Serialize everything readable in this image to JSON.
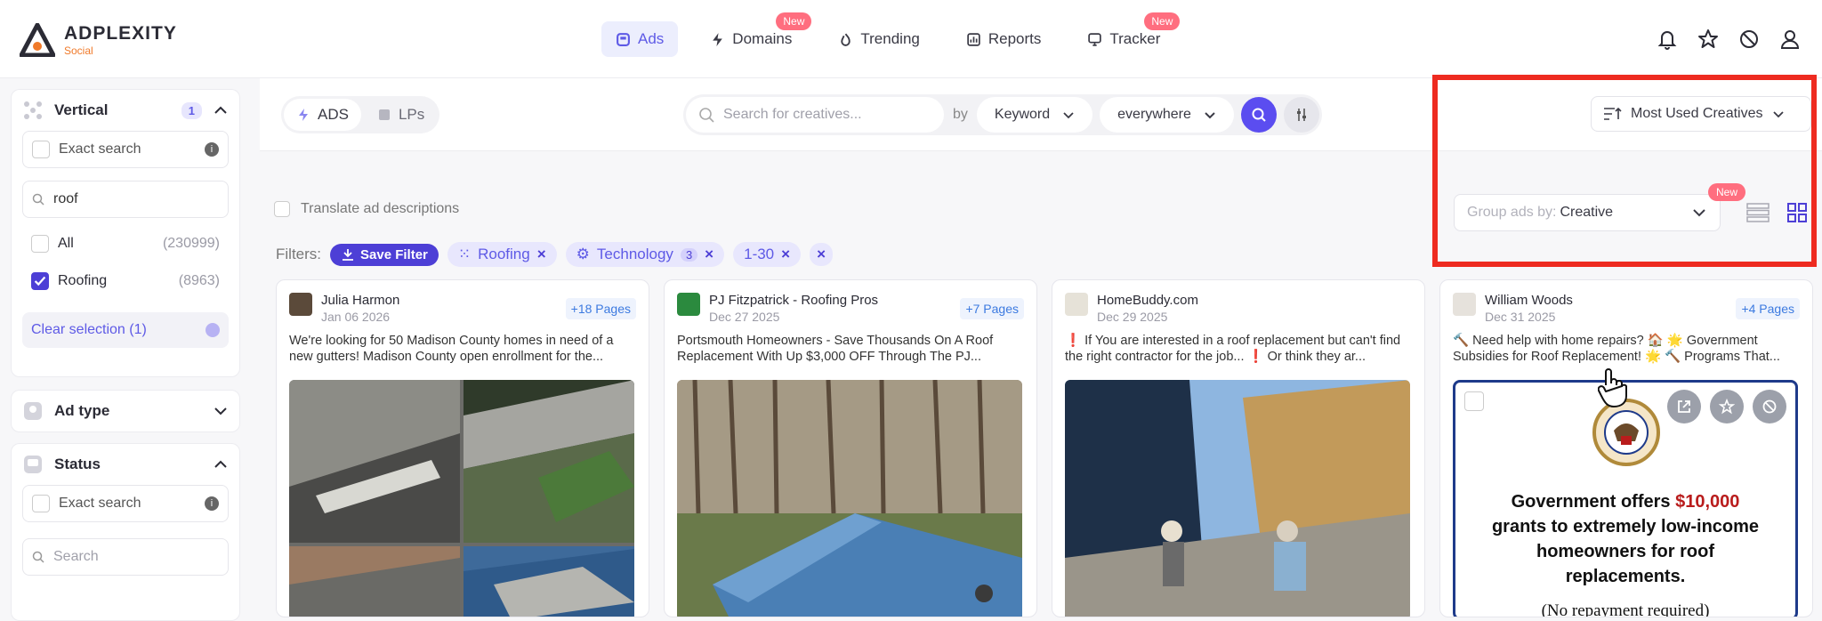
{
  "brand": {
    "title": "ADPLEXITY",
    "subtitle": "Social"
  },
  "nav": [
    {
      "label": "Ads",
      "active": true,
      "icon": "ads-icon"
    },
    {
      "label": "Domains",
      "badge": "New",
      "icon": "bolt-icon"
    },
    {
      "label": "Trending",
      "icon": "flame-icon"
    },
    {
      "label": "Reports",
      "icon": "chart-icon"
    },
    {
      "label": "Tracker",
      "badge": "New",
      "icon": "tracker-icon"
    }
  ],
  "sidebar": {
    "vertical": {
      "title": "Vertical",
      "count": "1",
      "exact_search": "Exact search",
      "search_value": "roof",
      "options": [
        {
          "label": "All",
          "count": "(230999)"
        },
        {
          "label": "Roofing",
          "count": "(8963)"
        }
      ],
      "clear": "Clear selection (1)"
    },
    "ad_type": {
      "title": "Ad type"
    },
    "status": {
      "title": "Status",
      "exact_search": "Exact search",
      "search_placeholder": "Search"
    }
  },
  "toolbar": {
    "seg": [
      {
        "label": "ADS"
      },
      {
        "label": "LPs"
      }
    ],
    "search_placeholder": "Search for creatives...",
    "by": "by",
    "keyword": "Keyword",
    "scope": "everywhere",
    "sort": "Most Used Creatives"
  },
  "translate": "Translate ad descriptions",
  "group_by": {
    "label": "Group ads by:",
    "value": "Creative",
    "badge": "New"
  },
  "filters": {
    "label": "Filters:",
    "save": "Save Filter",
    "chips": [
      {
        "label": "Roofing"
      },
      {
        "label": "Technology",
        "count": "3"
      },
      {
        "label": "1-30"
      }
    ]
  },
  "cards": [
    {
      "name": "Julia Harmon",
      "date": "Jan 06 2026",
      "pages": "+18 Pages",
      "text": "We're looking for 50 Madison County homes in need of a new gutters! Madison County open enrollment for the..."
    },
    {
      "name": "PJ Fitzpatrick - Roofing Pros",
      "date": "Dec 27 2025",
      "pages": "+7 Pages",
      "text": "Portsmouth Homeowners - Save Thousands On A Roof Replacement With Up $3,000 OFF Through The PJ..."
    },
    {
      "name": "HomeBuddy.com",
      "date": "Dec 29 2025",
      "pages": "",
      "text": "❗ If You are interested in a roof replacement but can't find the right contractor for the job... ❗ Or think they ar..."
    },
    {
      "name": "William Woods",
      "date": "Dec 31 2025",
      "pages": "+4 Pages",
      "text": "🔨 Need help with home repairs? 🏠 🌟 Government Subsidies for Roof Replacement! 🌟 🔨 Programs That...",
      "ad": {
        "line1": "Government offers",
        "amount": "$10,000",
        "line2": "grants to extremely low-income",
        "line3": "homeowners for roof",
        "line4": "replacements.",
        "sub": "(No repayment required)"
      }
    }
  ]
}
